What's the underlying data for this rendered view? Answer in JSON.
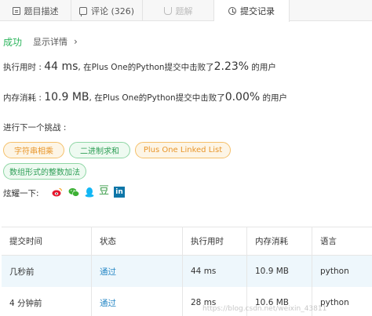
{
  "tabs": [
    {
      "label": "题目描述",
      "icon": "document-icon"
    },
    {
      "label": "评论 (326)",
      "icon": "comment-icon"
    },
    {
      "label": "题解",
      "icon": "flask-icon"
    },
    {
      "label": "提交记录",
      "icon": "clock-icon"
    }
  ],
  "result": {
    "status": "成功",
    "details_link": "显示详情",
    "chevron": "›"
  },
  "performance": {
    "runtime_label": "执行用时 : ",
    "runtime_value": "44 ms",
    "runtime_mid": ", 在Plus One的Python提交中击败了",
    "runtime_percent": "2.23%",
    "runtime_tail": " 的用户",
    "memory_label": "内存消耗 : ",
    "memory_value": "10.9 MB",
    "memory_mid": ", 在Plus One的Python提交中击败了",
    "memory_percent": "0.00%",
    "memory_tail": " 的用户"
  },
  "next_challenge": {
    "label": "进行下一个挑战 :",
    "items": [
      "字符串相乘",
      "二进制求和",
      "Plus One Linked List",
      "数组形式的整数加法"
    ]
  },
  "share": {
    "label": "炫耀一下:",
    "icons": [
      "weibo-icon",
      "wechat-icon",
      "qq-icon",
      "douban-icon",
      "linkedin-icon"
    ],
    "douban_glyph": "豆",
    "linkedin_glyph": "in"
  },
  "submissions": {
    "headers": [
      "提交时间",
      "状态",
      "执行用时",
      "内存消耗",
      "语言"
    ],
    "rows": [
      [
        "几秒前",
        "通过",
        "44 ms",
        "10.9 MB",
        "python"
      ],
      [
        "4 分钟前",
        "通过",
        "28 ms",
        "10.6 MB",
        "python"
      ]
    ]
  },
  "watermark": "https://blog.csdn.net/weixin_43811"
}
